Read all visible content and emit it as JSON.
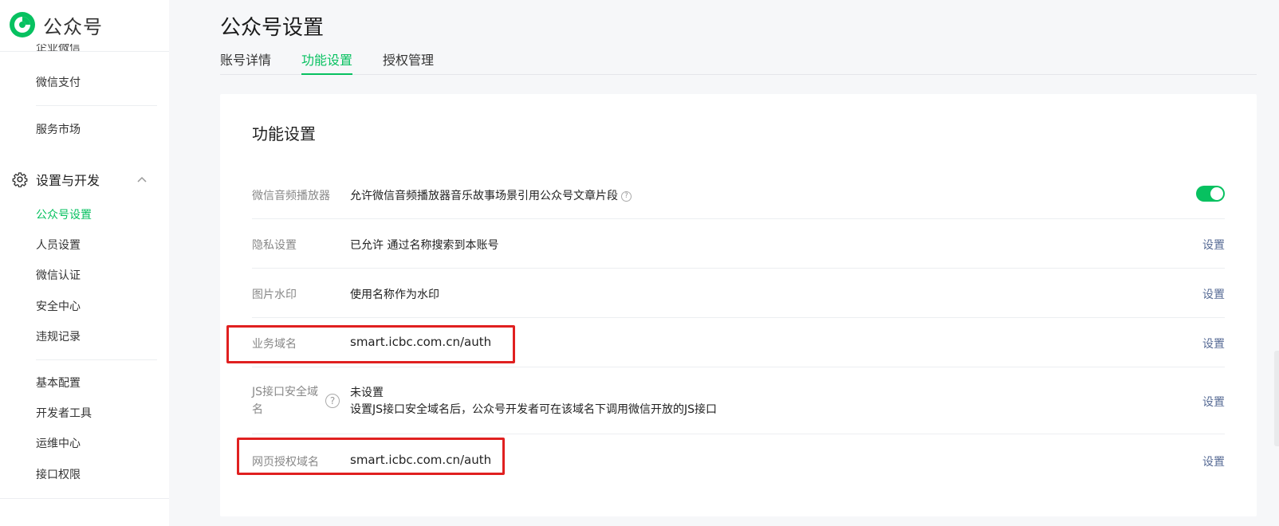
{
  "app": {
    "name": "公众号"
  },
  "sidebar": {
    "cut_item": "企业微信",
    "items_top": [
      {
        "label": "微信支付"
      },
      {
        "label": "服务市场"
      }
    ],
    "section": {
      "label": "设置与开发"
    },
    "items_settings": [
      {
        "label": "公众号设置",
        "active": true
      },
      {
        "label": "人员设置"
      },
      {
        "label": "微信认证"
      },
      {
        "label": "安全中心"
      },
      {
        "label": "违规记录"
      }
    ],
    "items_dev": [
      {
        "label": "基本配置"
      },
      {
        "label": "开发者工具"
      },
      {
        "label": "运维中心"
      },
      {
        "label": "接口权限"
      }
    ]
  },
  "page": {
    "title": "公众号设置"
  },
  "tabs": [
    {
      "label": "账号详情",
      "active": false
    },
    {
      "label": "功能设置",
      "active": true
    },
    {
      "label": "授权管理",
      "active": false
    }
  ],
  "card": {
    "title": "功能设置",
    "rows": [
      {
        "label": "微信音频播放器",
        "value": "允许微信音频播放器音乐故事场景引用公众号文章片段",
        "toggle_on": true
      },
      {
        "label": "隐私设置",
        "value": "已允许 通过名称搜索到本账号",
        "action": "设置"
      },
      {
        "label": "图片水印",
        "value": "使用名称作为水印",
        "action": "设置"
      },
      {
        "label": "业务域名",
        "value": "smart.icbc.com.cn/auth",
        "action": "设置",
        "highlighted": true
      },
      {
        "label": "JS接口安全域名",
        "value": "未设置",
        "sub_value": "设置JS接口安全域名后，公众号开发者可在该域名下调用微信开放的JS接口",
        "action": "设置"
      },
      {
        "label": "网页授权域名",
        "value": "smart.icbc.com.cn/auth",
        "action": "设置",
        "highlighted": true
      }
    ]
  },
  "colors": {
    "accent": "#07c160",
    "link": "#576b95",
    "highlight": "#e02020"
  },
  "icons": {
    "logo": "wechat-official-account-logo",
    "gear": "gear-icon",
    "chevron": "chevron-up-icon",
    "help": "question-circle-icon"
  }
}
